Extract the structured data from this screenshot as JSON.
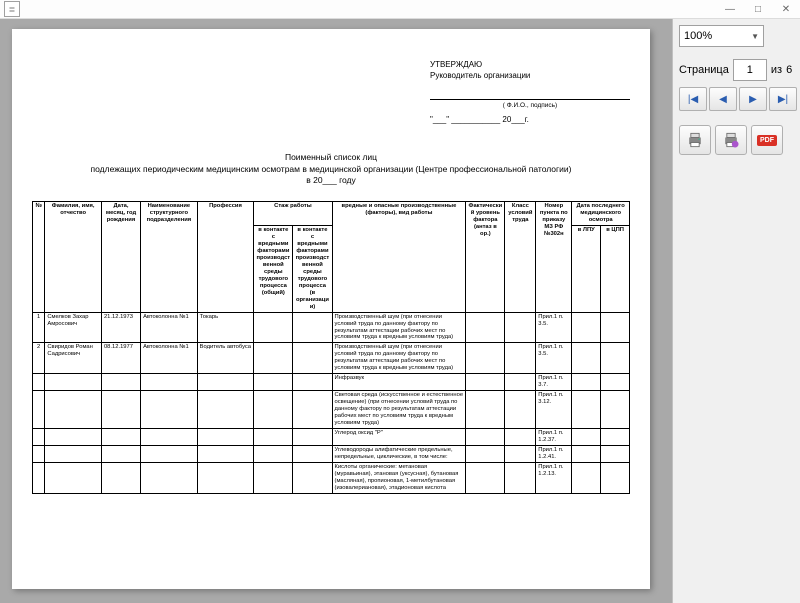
{
  "toolbar": {
    "zoom": "100%",
    "page_label": "Страница",
    "page_current": "1",
    "page_total_prefix": "из",
    "page_total": "6"
  },
  "approval": {
    "approve": "УТВЕРЖДАЮ",
    "head": "Руководитель организации",
    "fio_sub": "( Ф.И.О., подпись)",
    "date_template": "\"___\" ___________ 20___г."
  },
  "title": {
    "line1": "Поименный список лиц",
    "line2": "подлежащих периодическим медицинским осмотрам в медицинской организации (Центре профессиональной патологии)",
    "line3": "в 20___ году"
  },
  "headers": {
    "num": "№",
    "fio": "Фамилия, имя, отчество",
    "birth": "Дата, месяц, год рождения",
    "dept": "Наименование структурного подразделения",
    "prof": "Профессия",
    "staj": "Стаж работы",
    "staj1": "в контакте с вредными факторами производственной среды трудового процесса (общий)",
    "staj2": "в контакте с вредными факторами производственной среды трудового процесса (в организации)",
    "factors": "вредные и опасные производственные (факторы), вид работы",
    "fact_level": "Фактический уровень фактора (антаз в ор.)",
    "class": "Класс условий труда",
    "order": "Номер пункта по приказу МЗ РФ №302н",
    "lastmed": "Дата последнего медицинского осмотра",
    "lpu": "в ЛПУ",
    "cpp": "в ЦПП"
  },
  "rows": [
    {
      "n": "1",
      "fio": "Смелков Захар Амросович",
      "birth": "21.12.1973",
      "dept": "Автоколонна №1",
      "prof": "Токарь",
      "factor": "Производственный шум (при отнесении условий труда по данному фактору по результатам аттестации рабочих мест по условиям труда к вредным условиям труда)",
      "order": "Прил.1 п. 3.5."
    },
    {
      "n": "2",
      "fio": "Свиридов Роман Садрисович",
      "birth": "08.12.1977",
      "dept": "Автоколонна №1",
      "prof": "Водитель автобуса",
      "factor": "Производственный шум (при отнесении условий труда по данному фактору по результатам аттестации рабочих мест по условиям труда к вредным условиям труда)",
      "order": "Прил.1 п. 3.5."
    },
    {
      "n": "",
      "fio": "",
      "birth": "",
      "dept": "",
      "prof": "",
      "factor": "Инфразвук",
      "order": "Прил.1 п. 3.7."
    },
    {
      "n": "",
      "fio": "",
      "birth": "",
      "dept": "",
      "prof": "",
      "factor": "Световая среда (искусственное и естественное освещение) (при отнесении условий труда по данному фактору по результатам аттестации рабочих мест по условиям труда к вредным условиям труда)",
      "order": "Прил.1 п. 3.12."
    },
    {
      "n": "",
      "fio": "",
      "birth": "",
      "dept": "",
      "prof": "",
      "factor": "Углерод оксид \"Р\"",
      "order": "Прил.1 п. 1.2.37."
    },
    {
      "n": "",
      "fio": "",
      "birth": "",
      "dept": "",
      "prof": "",
      "factor": "Углеводороды алифатические предельные, непредельные, циклические, в том числе:",
      "order": "Прил.1 п. 1.2.41."
    },
    {
      "n": "",
      "fio": "",
      "birth": "",
      "dep": "",
      "prof": "",
      "factor": "Кислоты органические: метановая (муравьиная), этановая (уксусная), бутановая (масляная), пропионовая, 1-метилбутановая (изовалериановая), этадионовая кислота",
      "order": "Прил.1 п. 1.2.13."
    }
  ]
}
